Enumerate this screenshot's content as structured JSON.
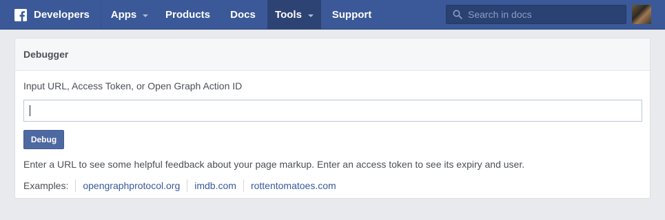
{
  "topbar": {
    "brand_label": "Developers",
    "nav": [
      {
        "label": "Apps"
      },
      {
        "label": "Products"
      },
      {
        "label": "Docs"
      },
      {
        "label": "Tools"
      },
      {
        "label": "Support"
      }
    ],
    "search_placeholder": "Search in docs",
    "active_tab": "Tools"
  },
  "debugger": {
    "title": "Debugger",
    "input_label": "Input URL, Access Token, or Open Graph Action ID",
    "input_value": "",
    "button_label": "Debug",
    "help_text": "Enter a URL to see some helpful feedback about your page markup. Enter an access token to see its expiry and user.",
    "examples_label": "Examples:",
    "examples": [
      "opengraphprotocol.org",
      "imdb.com",
      "rottentomatoes.com"
    ]
  },
  "colors": {
    "topbar_bg": "#3b5998",
    "active_tab_bg": "#2d4373",
    "button_bg": "#4e69a2",
    "link": "#365899",
    "page_bg": "#e9eaed"
  }
}
